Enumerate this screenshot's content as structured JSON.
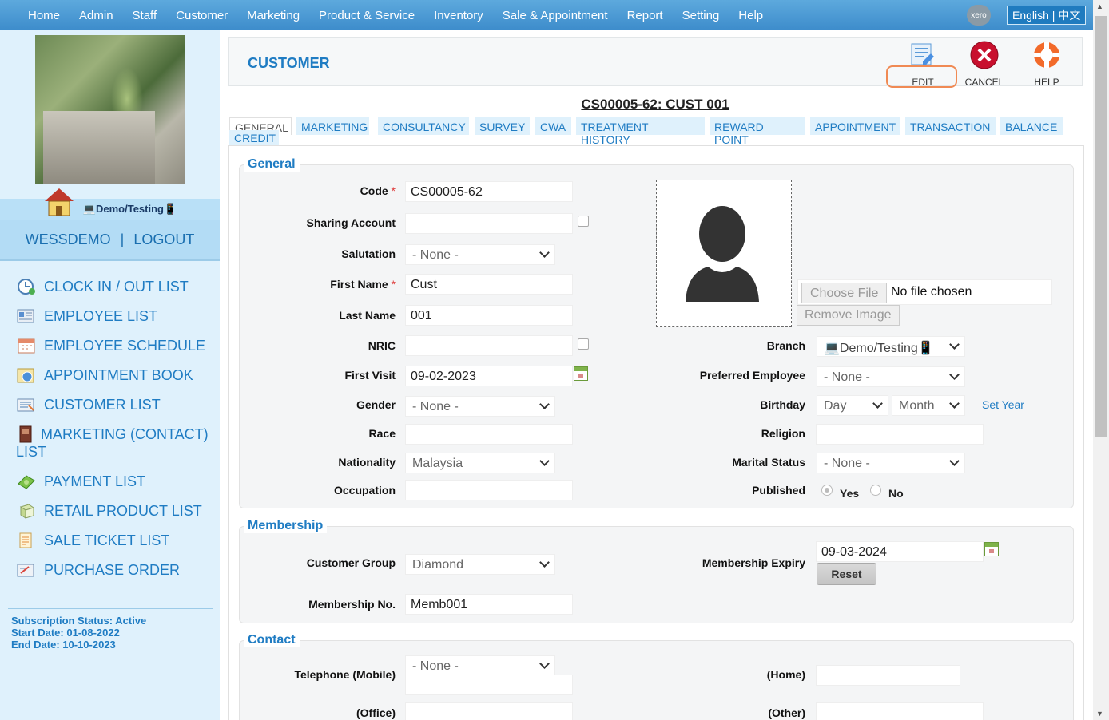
{
  "topnav": {
    "items": [
      "Home",
      "Admin",
      "Staff",
      "Customer",
      "Marketing",
      "Product & Service",
      "Inventory",
      "Sale & Appointment",
      "Report",
      "Setting",
      "Help"
    ],
    "xero_label": "xero",
    "language_label": "English | 中文"
  },
  "sidebar": {
    "branch_label": "💻Demo/Testing📱",
    "username": "WESSDEMO",
    "separator": "|",
    "logout": "LOGOUT",
    "menu": [
      {
        "label": "CLOCK IN / OUT LIST",
        "icon": "clock-icon"
      },
      {
        "label": "EMPLOYEE LIST",
        "icon": "employee-list-icon"
      },
      {
        "label": "EMPLOYEE SCHEDULE",
        "icon": "calendar-icon"
      },
      {
        "label": "APPOINTMENT BOOK",
        "icon": "appointment-icon"
      },
      {
        "label": "CUSTOMER LIST",
        "icon": "customer-list-icon"
      },
      {
        "label": "MARKETING (CONTACT) LIST",
        "icon": "contact-book-icon"
      },
      {
        "label": "PAYMENT LIST",
        "icon": "money-icon"
      },
      {
        "label": "RETAIL PRODUCT LIST",
        "icon": "product-box-icon"
      },
      {
        "label": "SALE TICKET LIST",
        "icon": "ticket-icon"
      },
      {
        "label": "PURCHASE ORDER",
        "icon": "purchase-order-icon"
      }
    ],
    "subscription": {
      "status": "Subscription Status: Active",
      "start": "Start Date: 01-08-2022",
      "end": "End Date: 10-10-2023"
    }
  },
  "header": {
    "title": "CUSTOMER",
    "edit": "EDIT",
    "cancel": "CANCEL",
    "help": "HELP"
  },
  "customer_title": "CS00005-62: CUST 001",
  "tabs": [
    "GENERAL",
    "MARKETING",
    "CONSULTANCY",
    "SURVEY",
    "CWA",
    "TREATMENT HISTORY",
    "REWARD POINT",
    "APPOINTMENT",
    "TRANSACTION",
    "BALANCE",
    "CREDIT"
  ],
  "general": {
    "legend": "General",
    "code_label": "Code",
    "code": "CS00005-62",
    "sharing_label": "Sharing Account",
    "sharing": "",
    "salutation_label": "Salutation",
    "salutation": "- None -",
    "first_name_label": "First Name",
    "first_name": "Cust",
    "last_name_label": "Last Name",
    "last_name": "001",
    "nric_label": "NRIC",
    "nric": "",
    "first_visit_label": "First Visit",
    "first_visit": "09-02-2023",
    "gender_label": "Gender",
    "gender": "- None -",
    "race_label": "Race",
    "race": "",
    "nationality_label": "Nationality",
    "nationality": "Malaysia",
    "occupation_label": "Occupation",
    "occupation": "",
    "choose_file": "Choose File",
    "no_file": "No file chosen",
    "remove_image": "Remove Image",
    "branch_label": "Branch",
    "branch": "💻Demo/Testing📱",
    "pref_emp_label": "Preferred Employee",
    "pref_emp": "- None -",
    "birthday_label": "Birthday",
    "bday_day": "Day",
    "bday_month": "Month",
    "set_year": "Set Year",
    "religion_label": "Religion",
    "religion": "",
    "marital_label": "Marital Status",
    "marital": "- None -",
    "published_label": "Published",
    "yes": "Yes",
    "no": "No"
  },
  "membership": {
    "legend": "Membership",
    "group_label": "Customer Group",
    "group": "Diamond",
    "expiry_label": "Membership Expiry",
    "expiry": "09-03-2024",
    "reset": "Reset",
    "no_label": "Membership No.",
    "no": "Memb001"
  },
  "contact": {
    "legend": "Contact",
    "mobile_label": "Telephone (Mobile)",
    "mobile_prefix": "- None -",
    "mobile": "",
    "home_label": "(Home)",
    "home": "",
    "office_label": "(Office)",
    "office": "",
    "other_label": "(Other)",
    "other": ""
  }
}
